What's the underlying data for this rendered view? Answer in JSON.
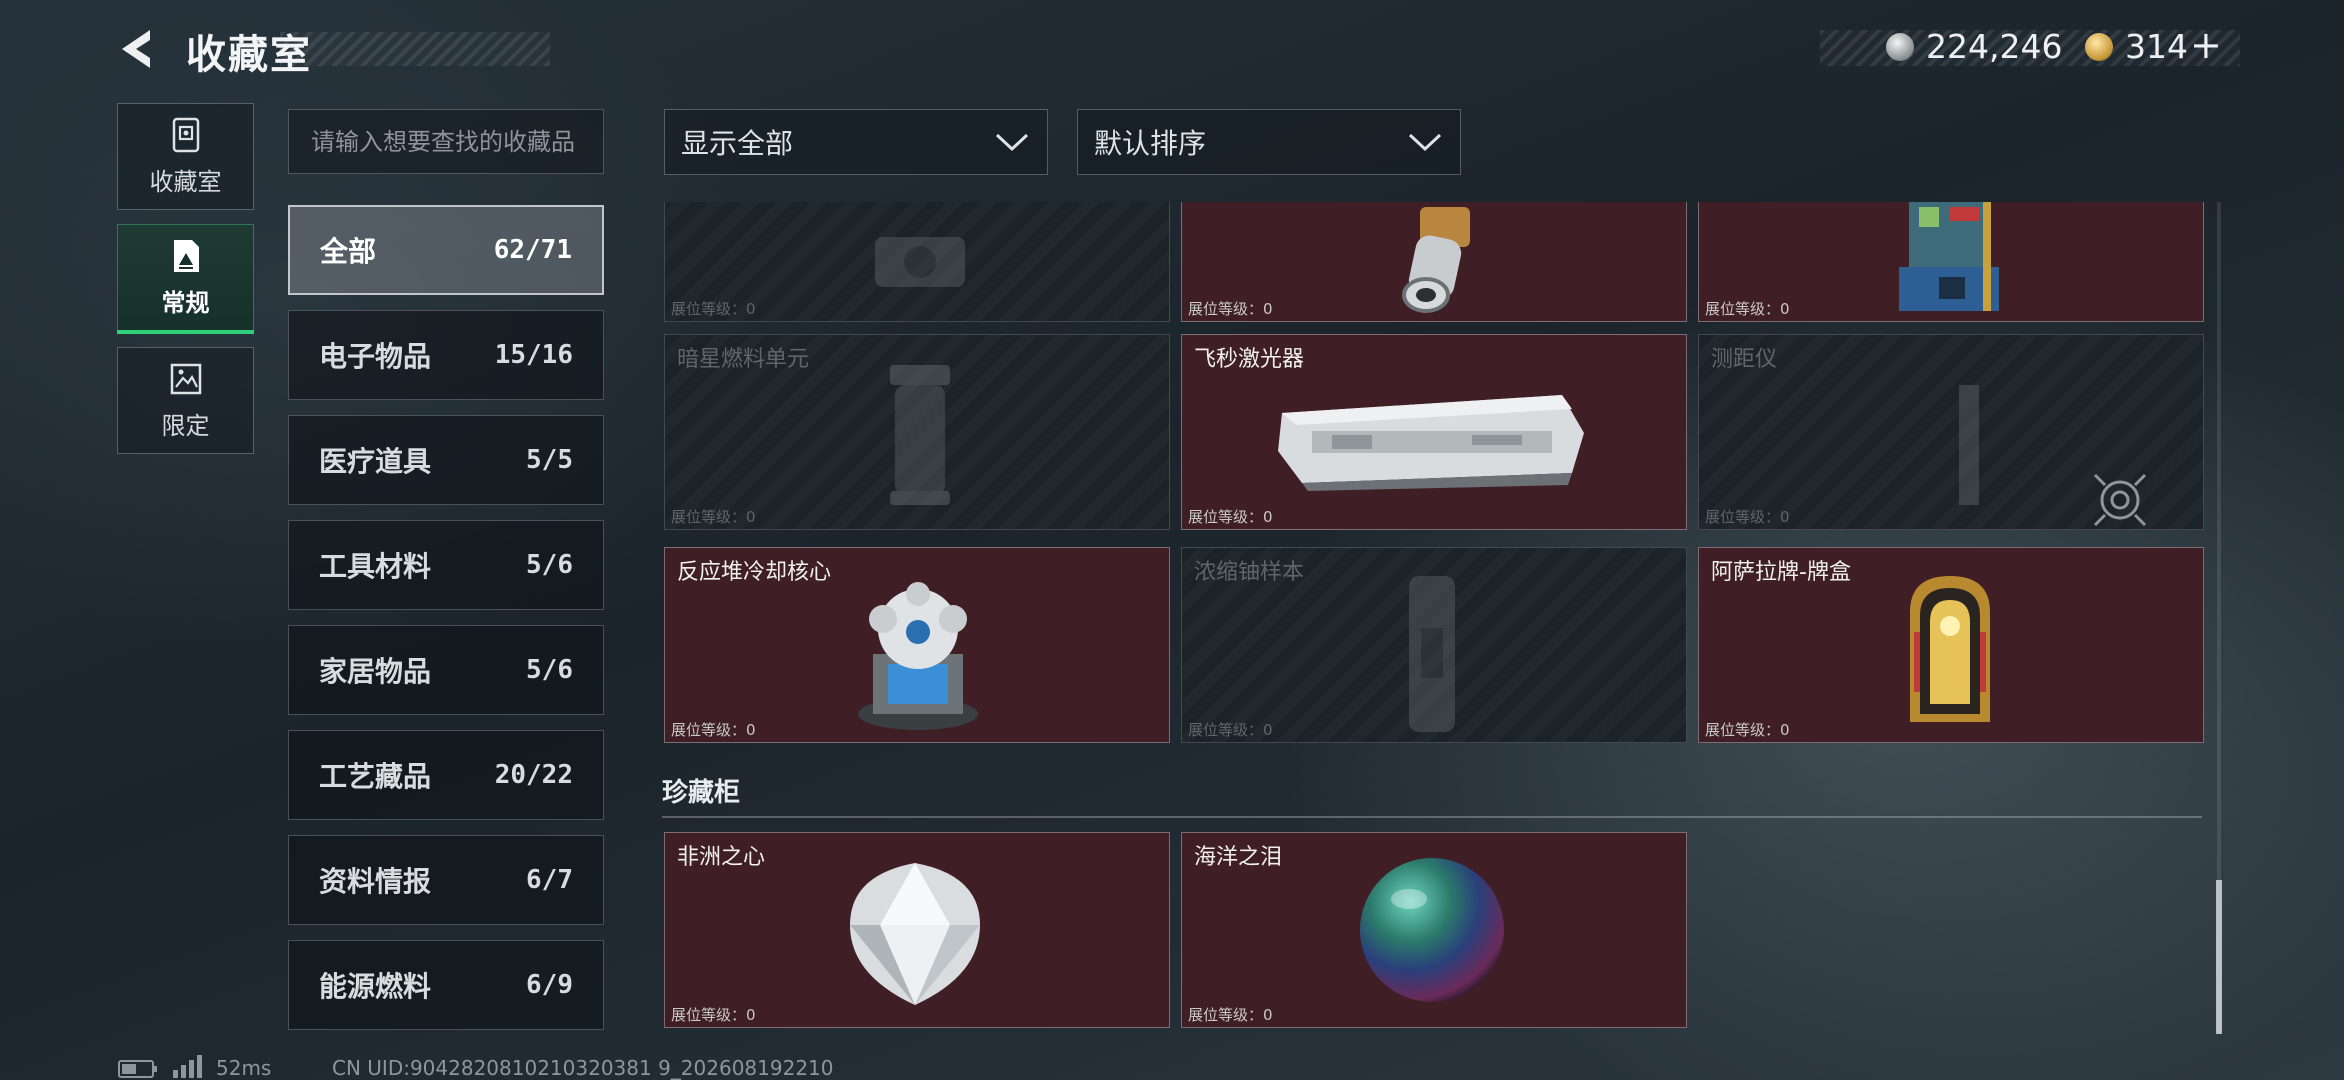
{
  "header": {
    "title": "收藏室"
  },
  "currency": {
    "silver": "224,246",
    "gold": "314",
    "plus": "+"
  },
  "nav": [
    {
      "label": "收藏室",
      "icon": "collection-icon",
      "active": false
    },
    {
      "label": "常规",
      "icon": "gallery-icon",
      "active": true
    },
    {
      "label": "限定",
      "icon": "limited-icon",
      "active": false
    }
  ],
  "search": {
    "placeholder": "请输入想要查找的收藏品"
  },
  "categories": [
    {
      "name": "全部",
      "count": "62/71",
      "active": true
    },
    {
      "name": "电子物品",
      "count": "15/16"
    },
    {
      "name": "医疗道具",
      "count": "5/5"
    },
    {
      "name": "工具材料",
      "count": "5/6"
    },
    {
      "name": "家居物品",
      "count": "5/6"
    },
    {
      "name": "工艺藏品",
      "count": "20/22"
    },
    {
      "name": "资料情报",
      "count": "6/7"
    },
    {
      "name": "能源燃料",
      "count": "6/9"
    }
  ],
  "filters": {
    "display": "显示全部",
    "sort": "默认排序"
  },
  "level_label": "展位等级：0",
  "items": [
    {
      "name": "",
      "owned": false,
      "icon": "device-icon"
    },
    {
      "name": "",
      "owned": true,
      "icon": "lens-icon"
    },
    {
      "name": "",
      "owned": true,
      "icon": "machine-icon"
    },
    {
      "name": "暗星燃料单元",
      "owned": false,
      "icon": "fuel-cell-icon"
    },
    {
      "name": "飞秒激光器",
      "owned": true,
      "icon": "laser-icon"
    },
    {
      "name": "测距仪",
      "owned": false,
      "icon": "rangefinder-icon"
    },
    {
      "name": "反应堆冷却核心",
      "owned": true,
      "icon": "reactor-core-icon"
    },
    {
      "name": "浓缩铀样本",
      "owned": false,
      "icon": "uranium-sample-icon"
    },
    {
      "name": "阿萨拉牌-牌盒",
      "owned": true,
      "icon": "card-box-icon"
    }
  ],
  "treasure": {
    "title": "珍藏柜",
    "items": [
      {
        "name": "非洲之心",
        "owned": true,
        "icon": "diamond-icon"
      },
      {
        "name": "海洋之泪",
        "owned": true,
        "icon": "pearl-icon"
      }
    ]
  },
  "footer": {
    "ping": "52ms",
    "uid": "CN UID:9042820810210320381 9_202608192210"
  },
  "colors": {
    "owned_card": "#3f1f25",
    "active_accent": "#2fd07a",
    "locked_card": "#1c2328"
  }
}
